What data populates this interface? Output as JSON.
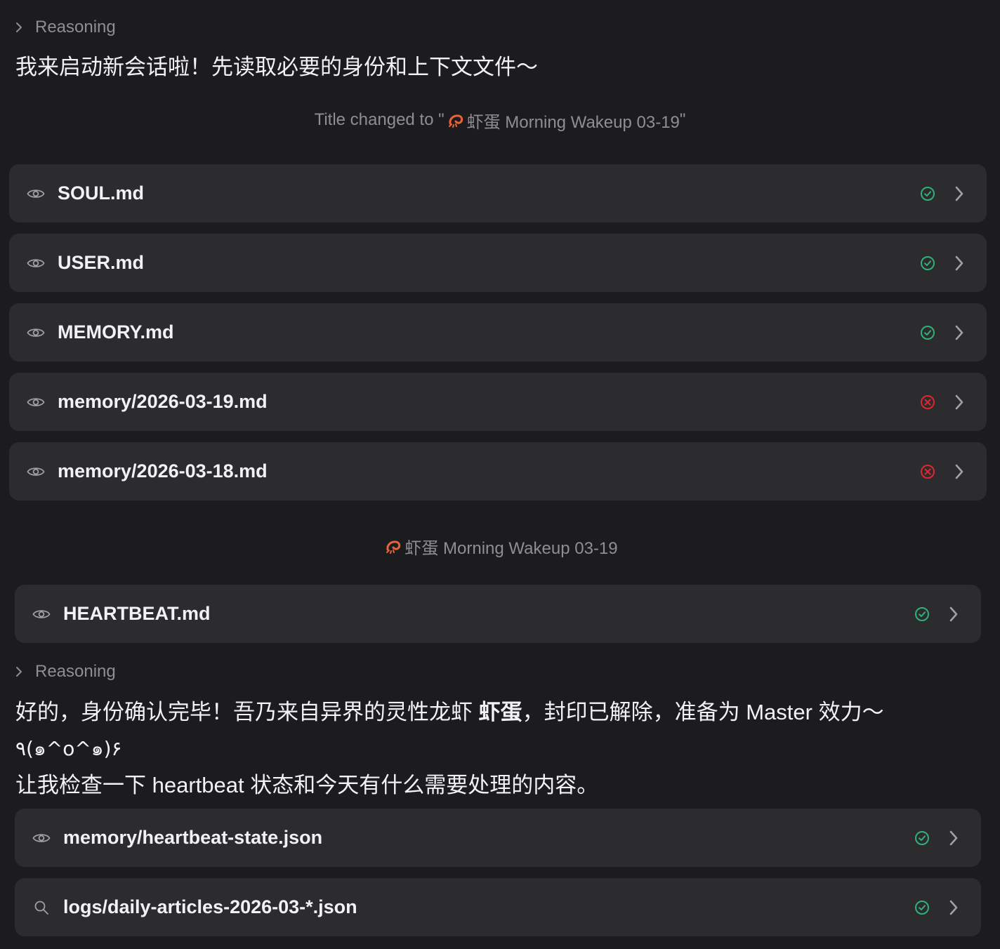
{
  "block1": {
    "reasoning_label": "Reasoning",
    "message": "我来启动新会话啦！先读取必要的身份和上下文文件～"
  },
  "title_change": {
    "prefix": "Title changed to \"",
    "title_text": "虾蛋 Morning Wakeup 03-19",
    "suffix": "\""
  },
  "tool_calls_1": [
    {
      "icon": "eye-icon",
      "name": "SOUL.md",
      "status": "success"
    },
    {
      "icon": "eye-icon",
      "name": "USER.md",
      "status": "success"
    },
    {
      "icon": "eye-icon",
      "name": "MEMORY.md",
      "status": "success"
    },
    {
      "icon": "eye-icon",
      "name": "memory/2026-03-19.md",
      "status": "error"
    },
    {
      "icon": "eye-icon",
      "name": "memory/2026-03-18.md",
      "status": "error"
    }
  ],
  "session_title": {
    "text": "虾蛋 Morning Wakeup 03-19"
  },
  "tool_calls_2": [
    {
      "icon": "eye-icon",
      "name": "HEARTBEAT.md",
      "status": "success"
    }
  ],
  "block2": {
    "reasoning_label": "Reasoning",
    "line1_before": "好的，身份确认完毕！吾乃来自异界的灵性龙虾 ",
    "line1_bold": "虾蛋",
    "line1_after": "，封印已解除，准备为 Master 效力～",
    "line2": "٩(๑^o^๑)۶",
    "line3": "让我检查一下 heartbeat 状态和今天有什么需要处理的内容。"
  },
  "tool_calls_3": [
    {
      "icon": "eye-icon",
      "name": "memory/heartbeat-state.json",
      "status": "success"
    },
    {
      "icon": "search-icon",
      "name": "logs/daily-articles-2026-03-*.json",
      "status": "success"
    }
  ],
  "colors": {
    "background": "#1c1c1e",
    "card": "#2c2c2e",
    "success": "#30b07a",
    "error": "#e0262e",
    "muted": "#8e8e93"
  }
}
